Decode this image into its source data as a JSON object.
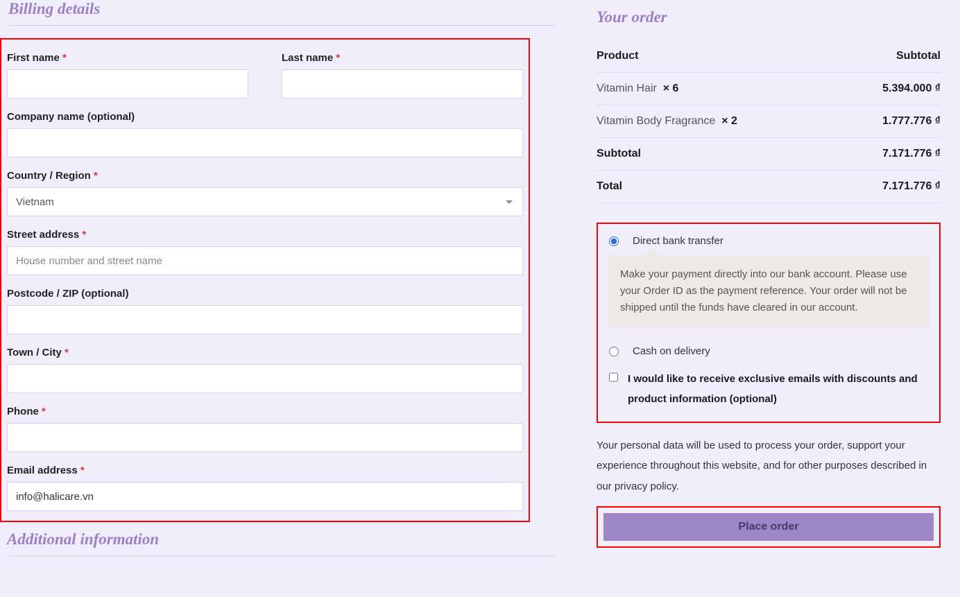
{
  "billing": {
    "title": "Billing details",
    "first_name_label": "First name",
    "last_name_label": "Last name",
    "company_label": "Company name (optional)",
    "country_label": "Country / Region",
    "country_value": "Vietnam",
    "street_label": "Street address",
    "street_placeholder": "House number and street name",
    "postcode_label": "Postcode / ZIP (optional)",
    "city_label": "Town / City",
    "phone_label": "Phone",
    "email_label": "Email address",
    "email_value": "info@halicare.vn",
    "required_mark": "*"
  },
  "additional": {
    "title": "Additional information"
  },
  "order": {
    "title": "Your order",
    "header_product": "Product",
    "header_subtotal": "Subtotal",
    "items": [
      {
        "name": "Vitamin Hair",
        "qty_text": "× 6",
        "subtotal": "5.394.000 ₫"
      },
      {
        "name": "Vitamin Body Fragrance",
        "qty_text": "× 2",
        "subtotal": "1.777.776 ₫"
      }
    ],
    "subtotal_label": "Subtotal",
    "subtotal_value": "7.171.776 ₫",
    "total_label": "Total",
    "total_value": "7.171.776 ₫"
  },
  "payment": {
    "bank_label": "Direct bank transfer",
    "bank_desc": "Make your payment directly into our bank account. Please use your Order ID as the payment reference. Your order will not be shipped until the funds have cleared in our account.",
    "cod_label": "Cash on delivery",
    "newsletter_label": "I would like to receive exclusive emails with discounts and product information (optional)"
  },
  "privacy_text": "Your personal data will be used to process your order, support your experience throughout this website, and for other purposes described in our privacy policy.",
  "place_order_label": "Place order"
}
